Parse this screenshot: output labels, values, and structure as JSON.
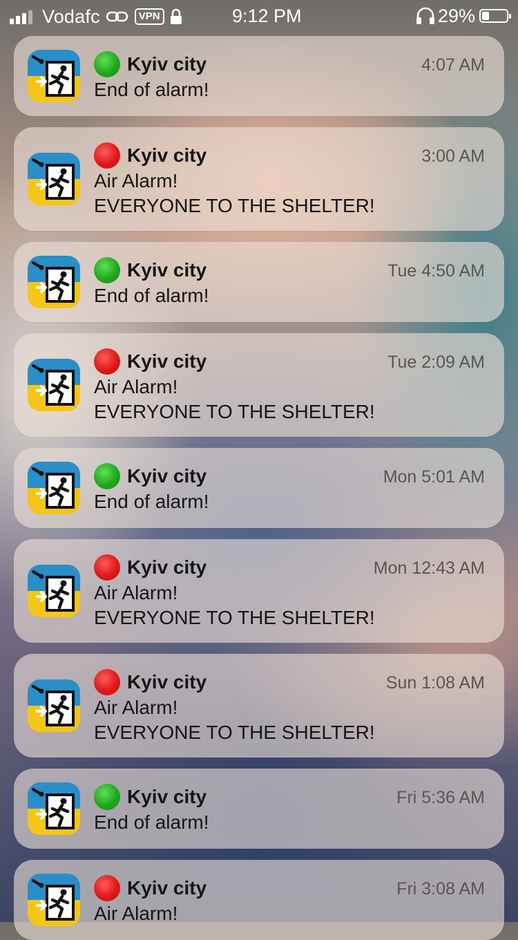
{
  "status_bar": {
    "carrier": "Vodafc",
    "vpn_label": "VPN",
    "time": "9:12 PM",
    "battery_percent": "29%",
    "battery_level": 0.29,
    "signal_bars_active": 3,
    "signal_bars_total": 4
  },
  "notifications": [
    {
      "icon": "air-alert-app-icon",
      "status": "green",
      "title": "Kyiv city",
      "time": "4:07 AM",
      "lines": [
        "End of alarm!"
      ]
    },
    {
      "icon": "air-alert-app-icon",
      "status": "red",
      "title": "Kyiv city",
      "time": "3:00 AM",
      "lines": [
        "Air Alarm!",
        "EVERYONE TO THE SHELTER!"
      ]
    },
    {
      "icon": "air-alert-app-icon",
      "status": "green",
      "title": "Kyiv city",
      "time": "Tue 4:50 AM",
      "lines": [
        "End of alarm!"
      ]
    },
    {
      "icon": "air-alert-app-icon",
      "status": "red",
      "title": "Kyiv city",
      "time": "Tue 2:09 AM",
      "lines": [
        "Air Alarm!",
        "EVERYONE TO THE SHELTER!"
      ]
    },
    {
      "icon": "air-alert-app-icon",
      "status": "green",
      "title": "Kyiv city",
      "time": "Mon 5:01 AM",
      "lines": [
        "End of alarm!"
      ]
    },
    {
      "icon": "air-alert-app-icon",
      "status": "red",
      "title": "Kyiv city",
      "time": "Mon 12:43 AM",
      "lines": [
        "Air Alarm!",
        "EVERYONE TO THE SHELTER!"
      ]
    },
    {
      "icon": "air-alert-app-icon",
      "status": "red",
      "title": "Kyiv city",
      "time": "Sun 1:08 AM",
      "lines": [
        "Air Alarm!",
        "EVERYONE TO THE SHELTER!"
      ]
    },
    {
      "icon": "air-alert-app-icon",
      "status": "green",
      "title": "Kyiv city",
      "time": "Fri 5:36 AM",
      "lines": [
        "End of alarm!"
      ]
    },
    {
      "icon": "air-alert-app-icon",
      "status": "red",
      "title": "Kyiv city",
      "time": "Fri 3:08 AM",
      "lines": [
        "Air Alarm!"
      ]
    }
  ],
  "colors": {
    "status_green": "#1fa81c",
    "status_red": "#e01818",
    "icon_blue": "#2a8ec8",
    "icon_yellow": "#f5c518"
  }
}
